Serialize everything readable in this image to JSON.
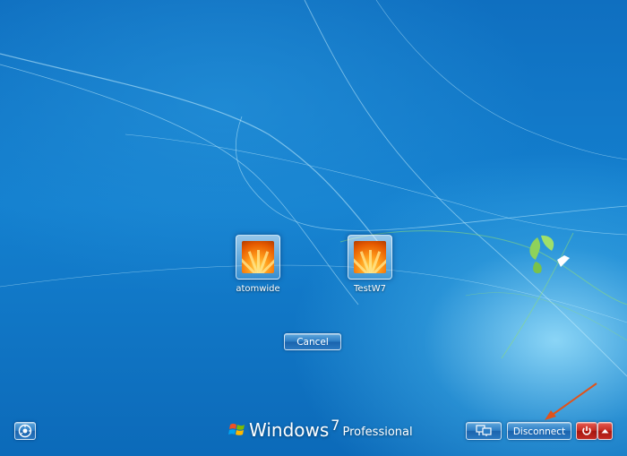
{
  "users": [
    {
      "name": "atomwide"
    },
    {
      "name": "TestW7"
    }
  ],
  "buttons": {
    "cancel": "Cancel",
    "disconnect": "Disconnect"
  },
  "branding": {
    "os_name": "Windows",
    "version": "7",
    "edition": "Professional"
  },
  "icons": {
    "ease_of_access": "ease-of-access-icon",
    "network": "network-icon",
    "power": "power-icon",
    "arrow": "chevron-up-icon"
  },
  "colors": {
    "background": "#1480cf",
    "button_blue": "#2b7cc4",
    "power_red": "#c52a20",
    "annotation_arrow": "#e0531b"
  }
}
